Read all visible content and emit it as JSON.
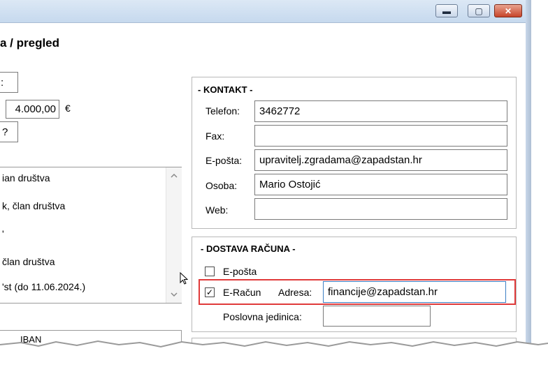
{
  "window": {
    "minimize_glyph": "▬",
    "maximize_glyph": "▢",
    "close_glyph": "✕"
  },
  "left": {
    "heading": "a / pregled",
    "field1_value": ":",
    "amount_value": "4.000,00",
    "currency": "€",
    "field3_value": "?",
    "members": [
      "ian društva",
      "k, član društva",
      "'",
      "član društva",
      "'st (do 11.06.2024.)"
    ],
    "iban_header": "IBAN"
  },
  "kontakt": {
    "title": "- KONTAKT -",
    "telefon_label": "Telefon:",
    "telefon_value": "3462772",
    "fax_label": "Fax:",
    "fax_value": "",
    "eposta_label": "E-pošta:",
    "eposta_value": "upravitelj.zgradama@zapadstan.hr",
    "osoba_label": "Osoba:",
    "osoba_value": "Mario Ostojić",
    "web_label": "Web:",
    "web_value": ""
  },
  "dostava": {
    "title": "- DOSTAVA RAČUNA -",
    "eposta_label": "E-pošta",
    "eposta_checked": false,
    "eracun_label": "E-Račun",
    "eracun_checked": true,
    "check_glyph": "✓",
    "adresa_label": "Adresa:",
    "adresa_value": "financije@zapadstan.hr",
    "poslovna_label": "Poslovna jedinica:",
    "poslovna_value": ""
  },
  "colors": {
    "highlight": "#e03a3a",
    "titlebar": "#c6d9ee"
  }
}
